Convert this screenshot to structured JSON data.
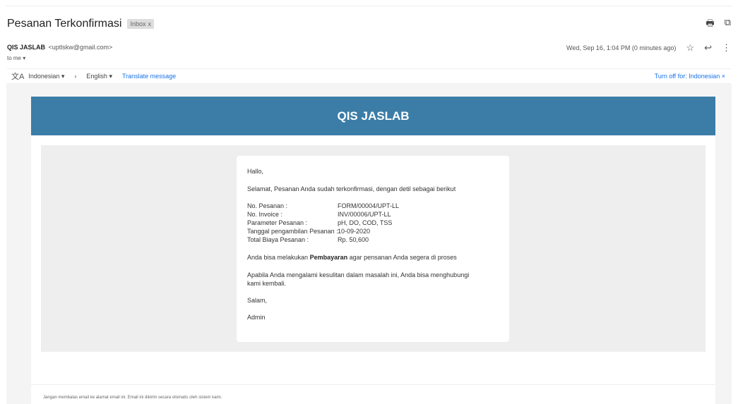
{
  "email": {
    "subject": "Pesanan Terkonfirmasi",
    "label": "Inbox",
    "label_close": "x",
    "sender_name": "QIS JASLAB",
    "sender_email": "<uptlskw@gmail.com>",
    "to_text": "to me",
    "date_text": "Wed, Sep 16, 1:04 PM (0 minutes ago)"
  },
  "translate": {
    "source_lang": "Indonesian",
    "target_lang": "English",
    "action": "Translate message",
    "turn_off": "Turn off for: Indonesian"
  },
  "body": {
    "banner_title": "QIS JASLAB",
    "greeting": "Hallo,",
    "intro": "Selamat, Pesanan Anda sudah terkonfirmasi, dengan detil sebagai berikut",
    "details": [
      {
        "label": "No. Pesanan :",
        "value": "FORM/00004/UPT-LL"
      },
      {
        "label": "No. Invoice :",
        "value": "INV/00006/UPT-LL"
      },
      {
        "label": "Parameter Pesanan :",
        "value": "pH, DO, COD, TSS"
      },
      {
        "label": "Tanggal pengambilan Pesanan :",
        "value": "10-09-2020"
      },
      {
        "label": "Total Biaya Pesanan :",
        "value": "Rp. 50,600"
      }
    ],
    "payment_pre": "Anda bisa melakukan",
    "payment_bold": "Pembayaran",
    "payment_post": "agar pensanan Anda segera di proses",
    "help_line1": "Apabila Anda mengalami kesulitan dalam masalah ini, Anda bisa menghubungi",
    "help_line2": "kami kembali.",
    "closing": "Salam,",
    "signature": "Admin",
    "footer": "Jangan membalas email ke alamat email ini. Email ini dikirim secara otomatis oleh sistem kami."
  },
  "icons": {
    "print": "print-icon",
    "open_new": "open-in-new-icon",
    "star": "star-icon",
    "reply": "reply-icon",
    "more": "more-vert-icon",
    "translate": "translate-icon"
  }
}
